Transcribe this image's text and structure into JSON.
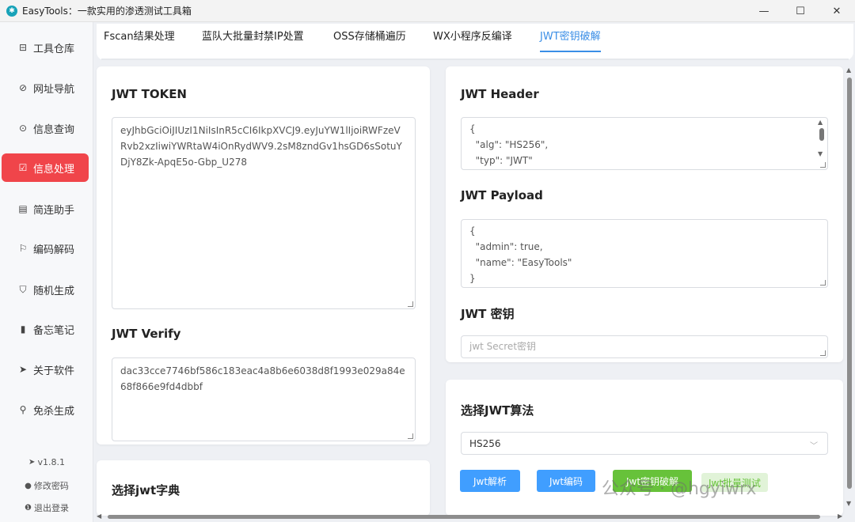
{
  "window": {
    "title": "EasyTools：一款实用的渗透测试工具箱",
    "min_icon": "—",
    "max_icon": "☐",
    "close_icon": "✕"
  },
  "sidebar": {
    "items": [
      {
        "label": "工具仓库",
        "icon": "⊟"
      },
      {
        "label": "网址导航",
        "icon": "⊘"
      },
      {
        "label": "信息查询",
        "icon": "⊙"
      },
      {
        "label": "信息处理",
        "icon": "☑"
      },
      {
        "label": "简连助手",
        "icon": "▤"
      },
      {
        "label": "编码解码",
        "icon": "⚐"
      },
      {
        "label": "随机生成",
        "icon": "⛉"
      },
      {
        "label": "备忘笔记",
        "icon": "▮"
      },
      {
        "label": "关于软件",
        "icon": "➤"
      },
      {
        "label": "免杀生成",
        "icon": "⚲"
      }
    ],
    "version": "v1.8.1",
    "change_password": "修改密码",
    "logout": "退出登录"
  },
  "tabs": [
    {
      "label": "Fscan结果处理"
    },
    {
      "label": "蓝队大批量封禁IP处置"
    },
    {
      "label": "OSS存储桶遍历"
    },
    {
      "label": "WX小程序反编译"
    },
    {
      "label": "JWT密钥破解"
    }
  ],
  "left": {
    "token_title": "JWT TOKEN",
    "token_value": "eyJhbGciOiJIUzI1NiIsInR5cCI6IkpXVCJ9.eyJuYW1lIjoiRWFzeVRvb2xzIiwiYWRtaW4iOnRydWV9.2sM8zndGv1hsGD6sSotuYDjY8Zk-ApqE5o-Gbp_U278",
    "verify_title": "JWT Verify",
    "verify_value": "dac33cce7746bf586c183eac4a8b6e6038d8f1993e029a84e68f866e9fd4dbbf",
    "dict_title": "选择jwt字典"
  },
  "right": {
    "header_title": "JWT Header",
    "header_lines": [
      "{",
      "  \"alg\": \"HS256\",",
      "  \"typ\": \"JWT\""
    ],
    "payload_title": "JWT Payload",
    "payload_lines": [
      "{",
      "  \"admin\": true,",
      "  \"name\": \"EasyTools\"",
      "}"
    ],
    "secret_title": "JWT 密钥",
    "secret_placeholder": "jwt Secret密钥",
    "algo_title": "选择JWT算法",
    "algo_value": "HS256",
    "buttons": {
      "parse": "Jwt解析",
      "encode": "Jwt编码",
      "crack": "Jwt密钥破解",
      "extra": "Jwt批量测试"
    }
  },
  "watermark": "公众号 · @hgyiwrx",
  "colors": {
    "accent": "#409eff",
    "active_nav": "#f0454a",
    "green": "#67c23a"
  }
}
